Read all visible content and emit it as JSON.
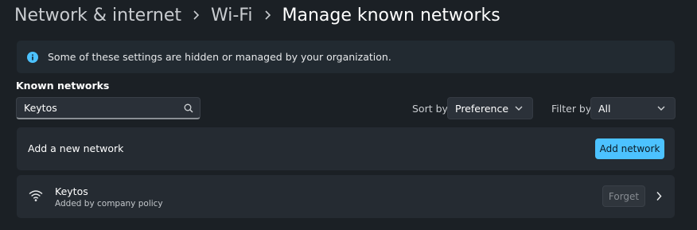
{
  "breadcrumb": {
    "items": [
      "Network & internet",
      "Wi-Fi",
      "Manage known networks"
    ]
  },
  "banner": {
    "text": "Some of these settings are hidden or managed by your organization.",
    "icon": "info-icon"
  },
  "known_networks": {
    "label": "Known networks",
    "search": {
      "value": "Keytos",
      "placeholder": "Search"
    },
    "sort": {
      "label": "Sort by:",
      "value": "Preference"
    },
    "filter": {
      "label": "Filter by:",
      "value": "All"
    }
  },
  "add_network": {
    "text": "Add a new network",
    "button": "Add network"
  },
  "networks": [
    {
      "name": "Keytos",
      "subtitle": "Added by company policy",
      "forget": "Forget",
      "icon": "wifi-icon"
    }
  ],
  "colors": {
    "accent": "#4cc2ff",
    "background": "#1b2025",
    "card": "#252b32"
  }
}
